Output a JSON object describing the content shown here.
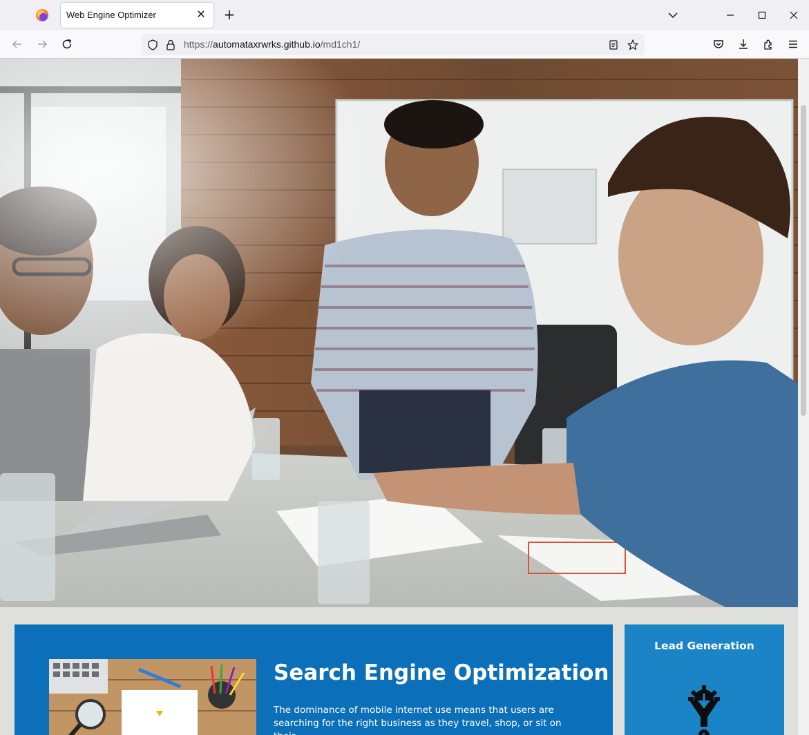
{
  "browser": {
    "tab_title": "Web Engine Optimizer",
    "tab_close_glyph": "✕",
    "new_tab_glyph": "+",
    "url_scheme": "https://",
    "url_host": "automataxrwrks.github.io",
    "url_path": "/md1ch1/",
    "icons": [
      "firefox-logo",
      "list-all-tabs-icon",
      "minimize-icon",
      "maximize-icon",
      "close-window-icon",
      "back-icon",
      "forward-icon",
      "reload-icon",
      "shield-icon",
      "lock-icon",
      "reader-view-icon",
      "bookmark-star-icon",
      "pocket-icon",
      "downloads-icon",
      "extensions-icon",
      "menu-icon"
    ]
  },
  "hero": {
    "image": "office-team-meeting-photo"
  },
  "seo": {
    "heading": "Search Engine Optimization",
    "body": "The dominance of mobile internet use means that users are searching for the right business as they travel, shop, or sit on their"
  },
  "lead": {
    "heading": "Lead Generation",
    "icon": "gear-funnel-dollar-icon"
  },
  "colors": {
    "seo_panel": "#0b6fba",
    "lead_panel": "#1a84c6",
    "page_bg": "#dfe0dc"
  }
}
